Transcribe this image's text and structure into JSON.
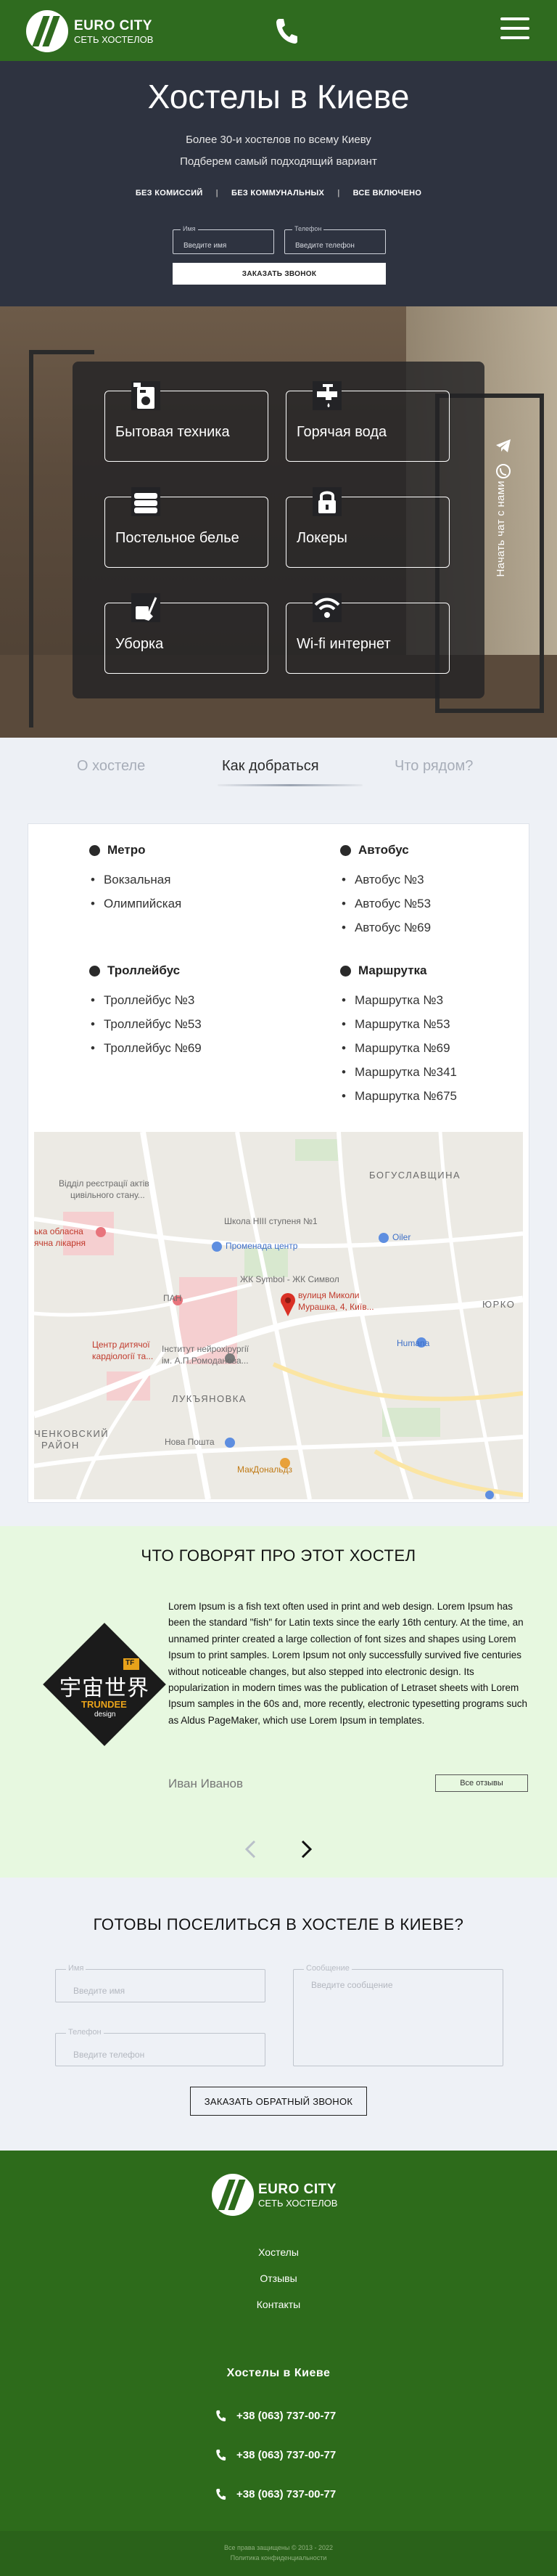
{
  "header": {
    "brand_line1": "EURO CITY",
    "brand_line2": "СЕТЬ ХОСТЕЛОВ",
    "phone_icon": "phone-icon",
    "menu_icon": "hamburger-menu-icon"
  },
  "hero": {
    "title": "Хостелы в Киеве",
    "subtitle_line1": "Более 30-и хостелов по всему Киеву",
    "subtitle_line2": "Подберем самый подходящий вариант",
    "features": [
      "БЕЗ КОМИССИЙ",
      "БЕЗ КОММУНАЛЬНЫХ",
      "ВСЕ ВКЛЮЧЕНО"
    ],
    "form": {
      "name_label": "Имя",
      "name_placeholder": "Введите имя",
      "phone_label": "Телефон",
      "phone_placeholder": "Введите телефон",
      "submit_label": "ЗАКАЗАТЬ ЗВОНОК"
    }
  },
  "amenities": {
    "items": [
      {
        "label": "Бытовая техника",
        "icon": "appliances-icon"
      },
      {
        "label": "Горячая вода",
        "icon": "faucet-icon"
      },
      {
        "label": "Постельное белье",
        "icon": "linen-icon"
      },
      {
        "label": "Локеры",
        "icon": "lock-icon"
      },
      {
        "label": "Уборка",
        "icon": "cleaning-icon"
      },
      {
        "label": "Wi-fi интернет",
        "icon": "wifi-icon"
      }
    ],
    "chat_label": "Начать чат с нами",
    "chat_icons": [
      "telegram-icon",
      "viber-icon"
    ]
  },
  "tabs": {
    "items": [
      "О хостеле",
      "Как добраться",
      "Что рядом?"
    ],
    "active": "Как добраться"
  },
  "transport": {
    "metro": {
      "title": "Метро",
      "items": [
        "Вокзальная",
        "Олимпийская"
      ]
    },
    "bus": {
      "title": "Автобус",
      "items": [
        "Автобус №3",
        "Автобус №53",
        "Автобус №69"
      ]
    },
    "trolley": {
      "title": "Троллейбус",
      "items": [
        "Троллейбус №3",
        "Троллейбус №53",
        "Троллейбус №69"
      ]
    },
    "minibus": {
      "title": "Маршрутка",
      "items": [
        "Маршрутка №3",
        "Маршрутка №53",
        "Маршрутка №69",
        "Маршрутка №341",
        "Маршрутка №675"
      ]
    }
  },
  "map": {
    "labels": {
      "registry": "Відділ реєстрації актів",
      "registry2": "цивільного стану...",
      "bogus": "БОГУСЛАВЩИНА",
      "hospital": "ька обласна",
      "hospital2": "ячна лікарня",
      "school": "Школа HIII ступеня №1",
      "oiler": "Oiler",
      "promenade": "Променада центр",
      "symbol": "ЖК Symbol - ЖК Символ",
      "pin1": "вулиця Миколи",
      "pin2": "Мурашка, 4, Київ...",
      "yurk": "ЮРКО",
      "pan": "ПАН",
      "center1": "Центр дитячої",
      "center2": "кардіології та...",
      "institute1": "Інститут нейрохірургії",
      "institute2": "ім. А.П.Ромоданова...",
      "humana": "Humana",
      "lukyanivka": "ЛУКЪЯНОВКА",
      "shev1": "ЧЕНКОВСКИЙ",
      "shev2": "РАЙОН",
      "novapost": "Нова Пошта",
      "mcd": "МакДональдз"
    }
  },
  "reviews": {
    "title": "ЧТО ГОВОРЯТ ПРО ЭТОТ ХОСТЕЛ",
    "logo_text_cn": "宇宙世界",
    "logo_text": "TRUNDEE",
    "logo_sub": "design",
    "logo_badge": "TF",
    "text": "Lorem Ipsum is a fish text often used in print and web design. Lorem Ipsum has been the standard \"fish\" for Latin texts since the early 16th century. At the time, an unnamed printer created a large collection of font sizes and shapes using Lorem Ipsum to print samples. Lorem Ipsum not only successfully survived five centuries without noticeable changes, but also stepped into electronic design. Its popularization in modern times was the publication of Letraset sheets with Lorem Ipsum samples in the 60s and, more recently, electronic typesetting programs such as Aldus PageMaker, which use Lorem Ipsum in templates.",
    "author": "Иван Иванов",
    "all_label": "Все отзывы"
  },
  "callback": {
    "title": "ГОТОВЫ ПОСЕЛИТЬСЯ В ХОСТЕЛЕ В КИЕВЕ?",
    "name_label": "Имя",
    "name_placeholder": "Введите имя",
    "phone_label": "Телефон",
    "phone_placeholder": "Введите телефон",
    "message_label": "Сообщение",
    "message_placeholder": "Введите сообщение",
    "submit_label": "ЗАКАЗАТЬ ОБРАТНЫЙ ЗВОНОК"
  },
  "footer": {
    "brand_line1": "EURO CITY",
    "brand_line2": "СЕТЬ ХОСТЕЛОВ",
    "nav": [
      "Хостелы",
      "Отзывы",
      "Контакты"
    ],
    "city_title": "Хостелы в Киеве",
    "phones": [
      "+38 (063) 737-00-77",
      "+38 (063) 737-00-77",
      "+38 (063) 737-00-77"
    ],
    "copyright": "Все права защищены © 2013 - 2022",
    "policy": "Политика конфиденциальности"
  },
  "colors": {
    "brand_green": "#2f6b1f",
    "hero_bg": "#2e3340",
    "reviews_bg": "#e7f8e0",
    "page_bg": "#eef1f6"
  }
}
